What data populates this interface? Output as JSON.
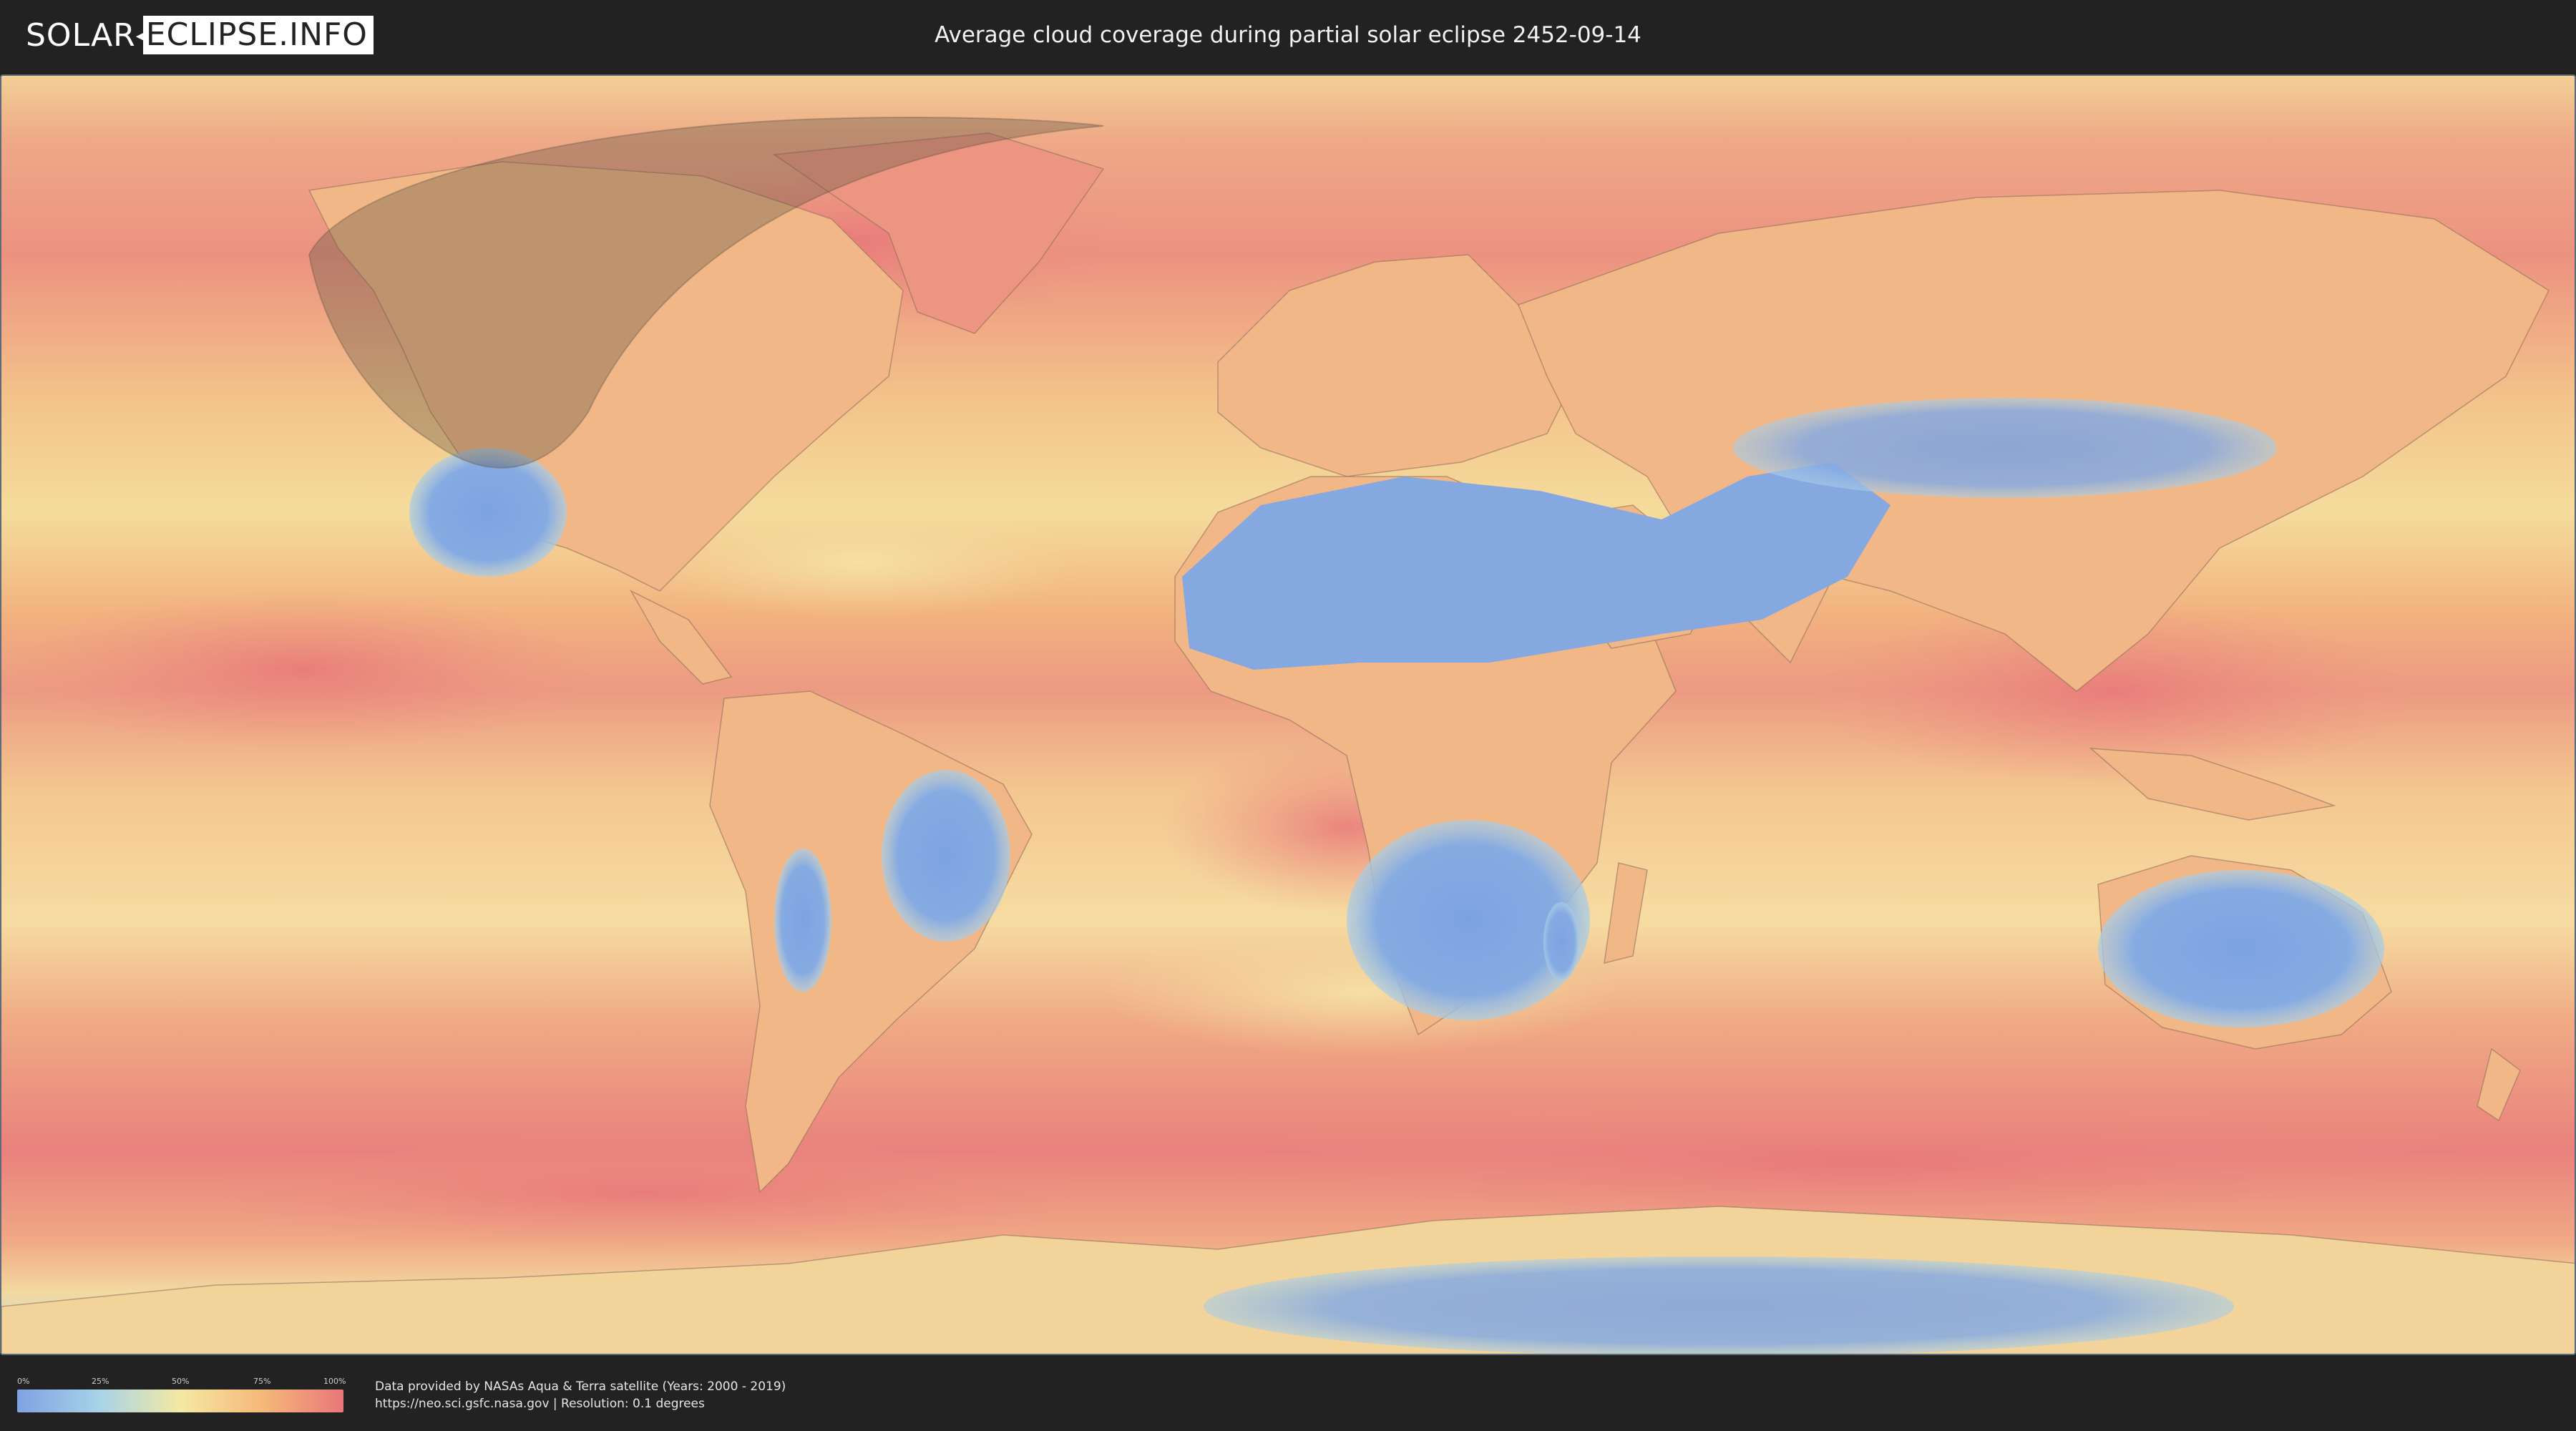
{
  "header": {
    "logo_left": "SOLAR",
    "logo_right": "ECLIPSE.INFO",
    "title": "Average cloud coverage during partial solar eclipse 2452-09-14"
  },
  "legend": {
    "ticks": [
      "0%",
      "25%",
      "50%",
      "75%",
      "100%"
    ],
    "colors": [
      "#7fa2e2",
      "#a6d3e8",
      "#f5e8a3",
      "#f5b97a",
      "#e9767b"
    ]
  },
  "footer": {
    "credit_line1": "Data provided by NASAs Aqua & Terra satellite (Years: 2000 - 2019)",
    "credit_line2": "https://neo.sci.gsfc.nasa.gov | Resolution: 0.1 degrees"
  },
  "map": {
    "projection": "equirectangular",
    "shadow_color": "#6b5e4a",
    "clear_sky_color": "#7fa2e2",
    "cloudy_color": "#e9767b"
  }
}
